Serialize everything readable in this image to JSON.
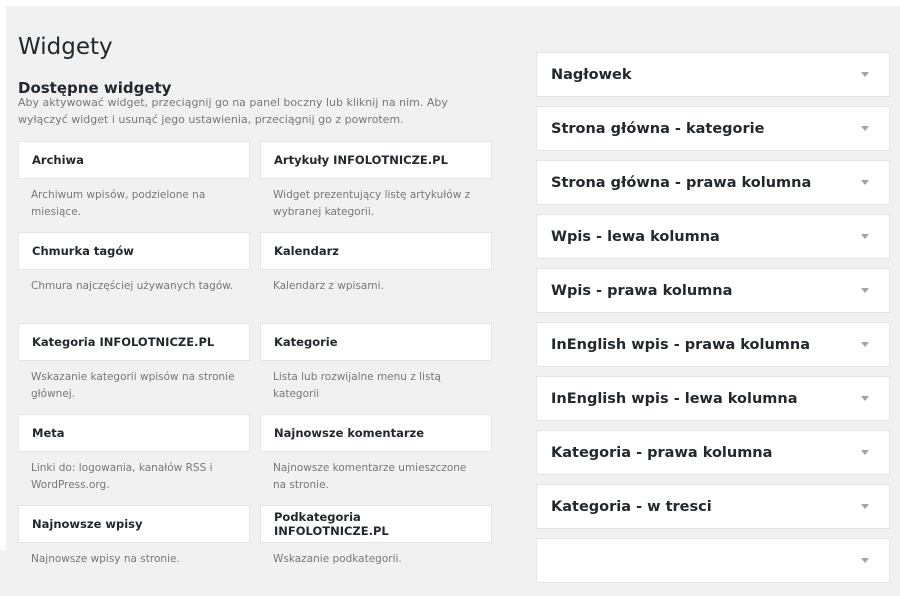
{
  "page": {
    "title": "Widgety"
  },
  "available": {
    "title": "Dostępne widgety",
    "description": "Aby aktywować widget, przeciągnij go na panel boczny lub kliknij na nim. Aby wyłączyć widget i usunąć jego ustawienia, przeciągnij go z powrotem.",
    "widgets": [
      {
        "name": "Archiwa",
        "desc": "Archiwum wpisów, podzielone na miesiące."
      },
      {
        "name": "Artykuły INFOLOTNICZE.PL",
        "desc": "Widget prezentujący listę artykułów z wybranej kategorii."
      },
      {
        "name": "Chmurka tagów",
        "desc": "Chmura najczęściej używanych tagów."
      },
      {
        "name": "Kalendarz",
        "desc": "Kalendarz z wpisami."
      },
      {
        "name": "Kategoria INFOLOTNICZE.PL",
        "desc": "Wskazanie kategorii wpisów na stronie głównej."
      },
      {
        "name": "Kategorie",
        "desc": "Lista lub rozwijalne menu z listą kategorii"
      },
      {
        "name": "Meta",
        "desc": "Linki do: logowania, kanałów RSS i WordPress.org."
      },
      {
        "name": "Najnowsze komentarze",
        "desc": "Najnowsze komentarze umieszczone na stronie."
      },
      {
        "name": "Najnowsze wpisy",
        "desc": "Najnowsze wpisy na stronie."
      },
      {
        "name": "Podkategoria INFOLOTNICZE.PL",
        "desc": "Wskazanie podkategorii."
      }
    ]
  },
  "sidebars": [
    {
      "title": "Nagłowek"
    },
    {
      "title": "Strona główna - kategorie"
    },
    {
      "title": "Strona główna - prawa kolumna"
    },
    {
      "title": "Wpis - lewa kolumna"
    },
    {
      "title": "Wpis - prawa kolumna"
    },
    {
      "title": "InEnglish wpis - prawa kolumna"
    },
    {
      "title": "InEnglish wpis - lewa kolumna"
    },
    {
      "title": "Kategoria - prawa kolumna"
    },
    {
      "title": "Kategoria - w tresci"
    },
    {
      "title": ""
    }
  ],
  "icons": {
    "toggle": "triangle-down-icon"
  },
  "colors": {
    "background": "#f1f1f1",
    "panel": "#ffffff",
    "border": "#e5e5e5",
    "text": "#23282d",
    "muted": "#777777",
    "toggle": "#a0a5aa"
  }
}
